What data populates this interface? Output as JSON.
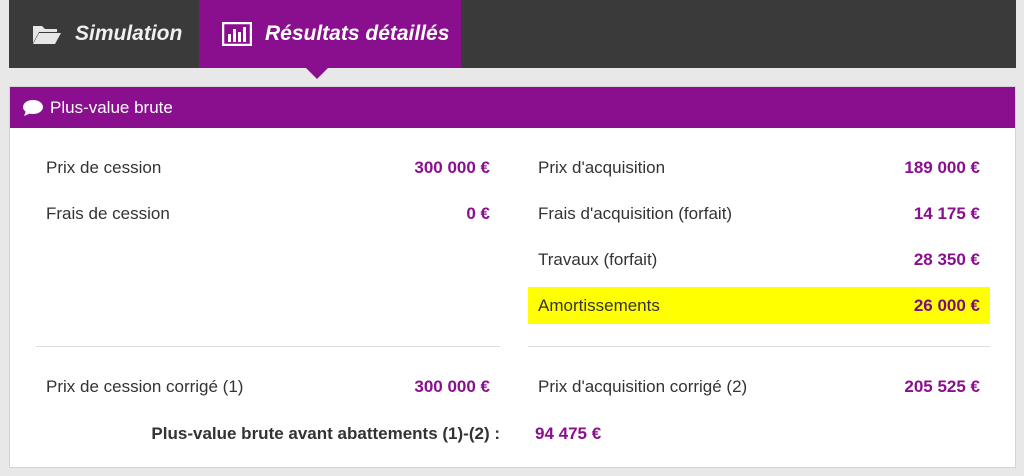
{
  "tabs": [
    {
      "label": "Simulation",
      "icon": "folder-open-icon"
    },
    {
      "label": "Résultats détaillés",
      "icon": "bar-chart-icon"
    }
  ],
  "panel": {
    "title": "Plus-value brute",
    "icon": "comment-icon"
  },
  "left": [
    {
      "label": "Prix de cession",
      "value": "300 000 €"
    },
    {
      "label": "Frais de cession",
      "value": "0 €"
    }
  ],
  "right": [
    {
      "label": "Prix d'acquisition",
      "value": "189 000 €"
    },
    {
      "label": "Frais d'acquisition (forfait)",
      "value": "14 175 €"
    },
    {
      "label": "Travaux (forfait)",
      "value": "28 350 €"
    },
    {
      "label": "Amortissements",
      "value": "26 000 €"
    }
  ],
  "corrected": {
    "cession_label": "Prix de cession corrigé (1)",
    "cession_value": "300 000 €",
    "acquisition_label": "Prix d'acquisition corrigé (2)",
    "acquisition_value": "205 525 €"
  },
  "total": {
    "label": "Plus-value brute avant abattements (1)-(2) :",
    "value": "94 475 €"
  },
  "colors": {
    "accent": "#8a0f8f",
    "tabbar": "#3a3a3a",
    "highlight": "#ffff00"
  }
}
